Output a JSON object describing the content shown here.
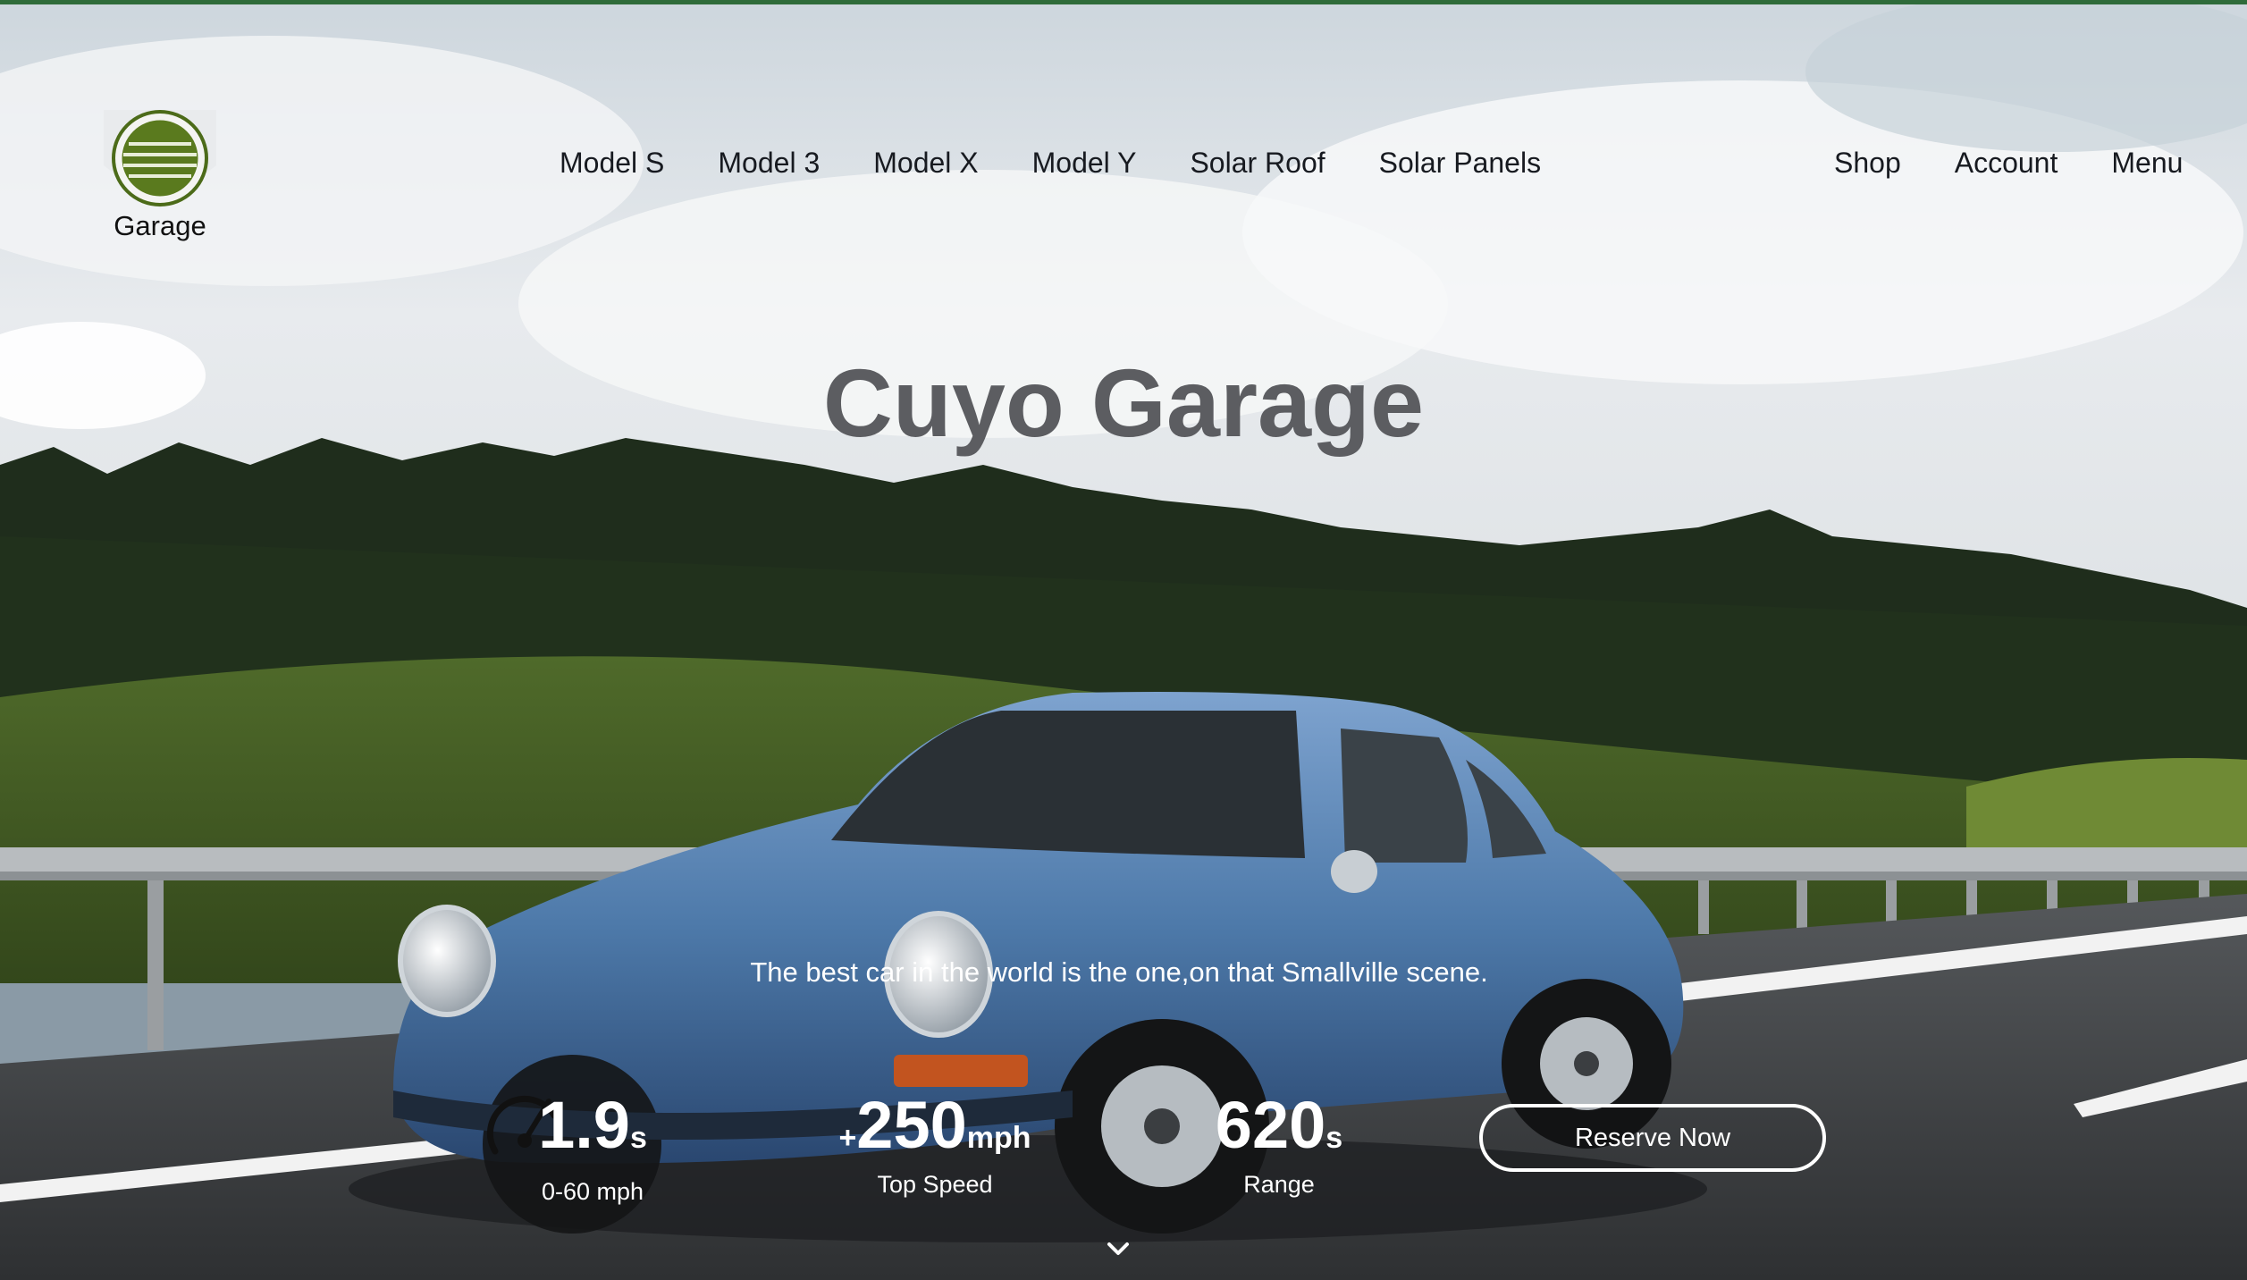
{
  "brand": {
    "logo_text": "Garage",
    "logo_color": "#5a7a1e"
  },
  "nav": {
    "main": [
      "Model S",
      "Model 3",
      "Model X",
      "Model Y",
      "Solar Roof",
      "Solar Panels"
    ],
    "right": [
      "Shop",
      "Account",
      "Menu"
    ]
  },
  "hero": {
    "title": "Cuyo Garage",
    "tagline": "The best car in the world is the one,on that Smallville scene."
  },
  "stats": [
    {
      "prefix": "",
      "value": "1.9",
      "unit": "s",
      "label": "0-60 mph"
    },
    {
      "prefix": "+",
      "value": "250",
      "unit": "mph",
      "label": "Top Speed"
    },
    {
      "prefix": "",
      "value": "620",
      "unit": "s",
      "label": "Range"
    }
  ],
  "cta": {
    "reserve_label": "Reserve Now"
  },
  "icons": {
    "gauge": "speedometer-icon",
    "scroll": "chevron-down-icon"
  },
  "colors": {
    "accent_bar": "#2f6b3a",
    "title": "#5c5d61",
    "nav_text": "#171a20",
    "car_body": "#4f7bab"
  }
}
